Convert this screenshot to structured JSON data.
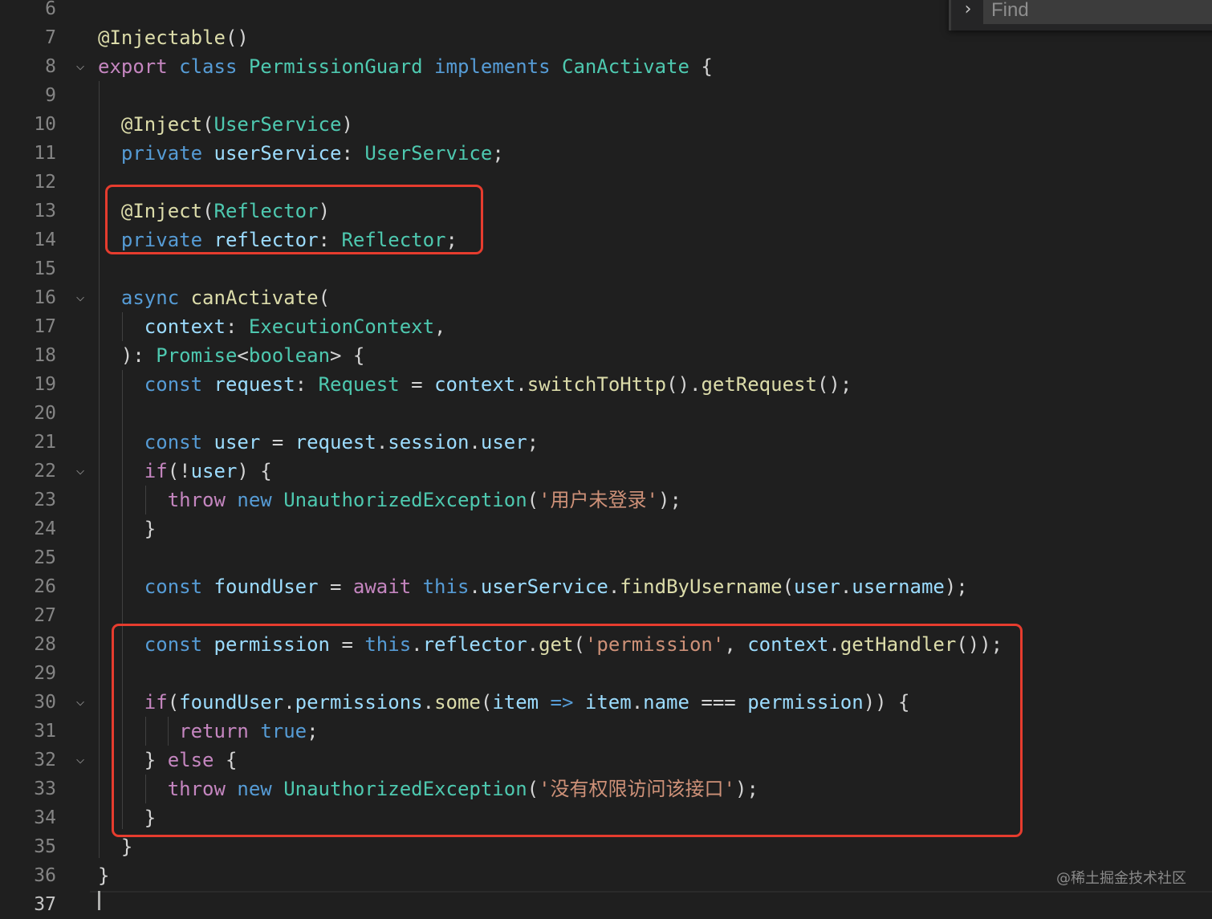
{
  "find": {
    "placeholder": "Find",
    "toggle_icon": "chevron-right-icon"
  },
  "watermark": "@稀土掘金技术社区",
  "colors": {
    "background": "#1f1f1f",
    "keyword": "#569cd6",
    "control": "#c586c0",
    "type": "#4ec9b0",
    "function": "#dcdcaa",
    "variable": "#9cdcfe",
    "string": "#ce9178",
    "highlight_box": "#e63c2e"
  },
  "lines": [
    {
      "n": "6",
      "fold": false,
      "tokens": []
    },
    {
      "n": "7",
      "fold": false,
      "tokens": [
        {
          "t": "@Injectable",
          "c": "deco"
        },
        {
          "t": "()",
          "c": "pun"
        }
      ]
    },
    {
      "n": "8",
      "fold": true,
      "tokens": [
        {
          "t": "export ",
          "c": "ctl"
        },
        {
          "t": "class ",
          "c": "kw"
        },
        {
          "t": "PermissionGuard ",
          "c": "ty"
        },
        {
          "t": "implements ",
          "c": "kw"
        },
        {
          "t": "CanActivate ",
          "c": "ty"
        },
        {
          "t": "{",
          "c": "pun"
        }
      ]
    },
    {
      "n": "9",
      "fold": false,
      "tokens": []
    },
    {
      "n": "10",
      "fold": false,
      "tokens": [
        {
          "t": "  ",
          "c": "pun"
        },
        {
          "t": "@Inject",
          "c": "deco"
        },
        {
          "t": "(",
          "c": "pun"
        },
        {
          "t": "UserService",
          "c": "ty"
        },
        {
          "t": ")",
          "c": "pun"
        }
      ]
    },
    {
      "n": "11",
      "fold": false,
      "tokens": [
        {
          "t": "  ",
          "c": "pun"
        },
        {
          "t": "private ",
          "c": "kw"
        },
        {
          "t": "userService",
          "c": "var"
        },
        {
          "t": ": ",
          "c": "pun"
        },
        {
          "t": "UserService",
          "c": "ty"
        },
        {
          "t": ";",
          "c": "pun"
        }
      ]
    },
    {
      "n": "12",
      "fold": false,
      "tokens": []
    },
    {
      "n": "13",
      "fold": false,
      "tokens": [
        {
          "t": "  ",
          "c": "pun"
        },
        {
          "t": "@Inject",
          "c": "deco"
        },
        {
          "t": "(",
          "c": "pun"
        },
        {
          "t": "Reflector",
          "c": "ty"
        },
        {
          "t": ")",
          "c": "pun"
        }
      ]
    },
    {
      "n": "14",
      "fold": false,
      "tokens": [
        {
          "t": "  ",
          "c": "pun"
        },
        {
          "t": "private ",
          "c": "kw"
        },
        {
          "t": "reflector",
          "c": "var"
        },
        {
          "t": ": ",
          "c": "pun"
        },
        {
          "t": "Reflector",
          "c": "ty"
        },
        {
          "t": ";",
          "c": "pun"
        }
      ]
    },
    {
      "n": "15",
      "fold": false,
      "tokens": []
    },
    {
      "n": "16",
      "fold": true,
      "tokens": [
        {
          "t": "  ",
          "c": "pun"
        },
        {
          "t": "async ",
          "c": "kw"
        },
        {
          "t": "canActivate",
          "c": "fn"
        },
        {
          "t": "(",
          "c": "pun"
        }
      ]
    },
    {
      "n": "17",
      "fold": false,
      "tokens": [
        {
          "t": "    ",
          "c": "pun"
        },
        {
          "t": "context",
          "c": "var"
        },
        {
          "t": ": ",
          "c": "pun"
        },
        {
          "t": "ExecutionContext",
          "c": "ty"
        },
        {
          "t": ",",
          "c": "pun"
        }
      ]
    },
    {
      "n": "18",
      "fold": false,
      "tokens": [
        {
          "t": "  ",
          "c": "pun"
        },
        {
          "t": "): ",
          "c": "pun"
        },
        {
          "t": "Promise",
          "c": "ty"
        },
        {
          "t": "<",
          "c": "pun"
        },
        {
          "t": "boolean",
          "c": "ty"
        },
        {
          "t": "> {",
          "c": "pun"
        }
      ]
    },
    {
      "n": "19",
      "fold": false,
      "tokens": [
        {
          "t": "    ",
          "c": "pun"
        },
        {
          "t": "const ",
          "c": "kw"
        },
        {
          "t": "request",
          "c": "var"
        },
        {
          "t": ": ",
          "c": "pun"
        },
        {
          "t": "Request",
          "c": "ty"
        },
        {
          "t": " = ",
          "c": "pun"
        },
        {
          "t": "context",
          "c": "var"
        },
        {
          "t": ".",
          "c": "pun"
        },
        {
          "t": "switchToHttp",
          "c": "fn"
        },
        {
          "t": "().",
          "c": "pun"
        },
        {
          "t": "getRequest",
          "c": "fn"
        },
        {
          "t": "();",
          "c": "pun"
        }
      ]
    },
    {
      "n": "20",
      "fold": false,
      "tokens": []
    },
    {
      "n": "21",
      "fold": false,
      "tokens": [
        {
          "t": "    ",
          "c": "pun"
        },
        {
          "t": "const ",
          "c": "kw"
        },
        {
          "t": "user",
          "c": "var"
        },
        {
          "t": " = ",
          "c": "pun"
        },
        {
          "t": "request",
          "c": "var"
        },
        {
          "t": ".",
          "c": "pun"
        },
        {
          "t": "session",
          "c": "var"
        },
        {
          "t": ".",
          "c": "pun"
        },
        {
          "t": "user",
          "c": "var"
        },
        {
          "t": ";",
          "c": "pun"
        }
      ]
    },
    {
      "n": "22",
      "fold": true,
      "tokens": [
        {
          "t": "    ",
          "c": "pun"
        },
        {
          "t": "if",
          "c": "ctl"
        },
        {
          "t": "(!",
          "c": "pun"
        },
        {
          "t": "user",
          "c": "var"
        },
        {
          "t": ") {",
          "c": "pun"
        }
      ]
    },
    {
      "n": "23",
      "fold": false,
      "tokens": [
        {
          "t": "      ",
          "c": "pun"
        },
        {
          "t": "throw ",
          "c": "ctl"
        },
        {
          "t": "new ",
          "c": "kw"
        },
        {
          "t": "UnauthorizedException",
          "c": "ty"
        },
        {
          "t": "(",
          "c": "pun"
        },
        {
          "t": "'用户未登录'",
          "c": "str"
        },
        {
          "t": ");",
          "c": "pun"
        }
      ]
    },
    {
      "n": "24",
      "fold": false,
      "tokens": [
        {
          "t": "    ",
          "c": "pun"
        },
        {
          "t": "}",
          "c": "pun"
        }
      ]
    },
    {
      "n": "25",
      "fold": false,
      "tokens": []
    },
    {
      "n": "26",
      "fold": false,
      "tokens": [
        {
          "t": "    ",
          "c": "pun"
        },
        {
          "t": "const ",
          "c": "kw"
        },
        {
          "t": "foundUser",
          "c": "var"
        },
        {
          "t": " = ",
          "c": "pun"
        },
        {
          "t": "await ",
          "c": "ctl"
        },
        {
          "t": "this",
          "c": "kw"
        },
        {
          "t": ".",
          "c": "pun"
        },
        {
          "t": "userService",
          "c": "var"
        },
        {
          "t": ".",
          "c": "pun"
        },
        {
          "t": "findByUsername",
          "c": "fn"
        },
        {
          "t": "(",
          "c": "pun"
        },
        {
          "t": "user",
          "c": "var"
        },
        {
          "t": ".",
          "c": "pun"
        },
        {
          "t": "username",
          "c": "var"
        },
        {
          "t": ");",
          "c": "pun"
        }
      ]
    },
    {
      "n": "27",
      "fold": false,
      "tokens": []
    },
    {
      "n": "28",
      "fold": false,
      "tokens": [
        {
          "t": "    ",
          "c": "pun"
        },
        {
          "t": "const ",
          "c": "kw"
        },
        {
          "t": "permission",
          "c": "var"
        },
        {
          "t": " = ",
          "c": "pun"
        },
        {
          "t": "this",
          "c": "kw"
        },
        {
          "t": ".",
          "c": "pun"
        },
        {
          "t": "reflector",
          "c": "var"
        },
        {
          "t": ".",
          "c": "pun"
        },
        {
          "t": "get",
          "c": "fn"
        },
        {
          "t": "(",
          "c": "pun"
        },
        {
          "t": "'permission'",
          "c": "str"
        },
        {
          "t": ", ",
          "c": "pun"
        },
        {
          "t": "context",
          "c": "var"
        },
        {
          "t": ".",
          "c": "pun"
        },
        {
          "t": "getHandler",
          "c": "fn"
        },
        {
          "t": "());",
          "c": "pun"
        }
      ]
    },
    {
      "n": "29",
      "fold": false,
      "tokens": []
    },
    {
      "n": "30",
      "fold": true,
      "tokens": [
        {
          "t": "    ",
          "c": "pun"
        },
        {
          "t": "if",
          "c": "ctl"
        },
        {
          "t": "(",
          "c": "pun"
        },
        {
          "t": "foundUser",
          "c": "var"
        },
        {
          "t": ".",
          "c": "pun"
        },
        {
          "t": "permissions",
          "c": "var"
        },
        {
          "t": ".",
          "c": "pun"
        },
        {
          "t": "some",
          "c": "fn"
        },
        {
          "t": "(",
          "c": "pun"
        },
        {
          "t": "item",
          "c": "var"
        },
        {
          "t": " => ",
          "c": "kw"
        },
        {
          "t": "item",
          "c": "var"
        },
        {
          "t": ".",
          "c": "pun"
        },
        {
          "t": "name",
          "c": "var"
        },
        {
          "t": " === ",
          "c": "pun"
        },
        {
          "t": "permission",
          "c": "var"
        },
        {
          "t": ")) {",
          "c": "pun"
        }
      ]
    },
    {
      "n": "31",
      "fold": false,
      "tokens": [
        {
          "t": "       ",
          "c": "pun"
        },
        {
          "t": "return ",
          "c": "ctl"
        },
        {
          "t": "true",
          "c": "kw"
        },
        {
          "t": ";",
          "c": "pun"
        }
      ]
    },
    {
      "n": "32",
      "fold": true,
      "tokens": [
        {
          "t": "    ",
          "c": "pun"
        },
        {
          "t": "} ",
          "c": "pun"
        },
        {
          "t": "else",
          "c": "ctl"
        },
        {
          "t": " {",
          "c": "pun"
        }
      ]
    },
    {
      "n": "33",
      "fold": false,
      "tokens": [
        {
          "t": "      ",
          "c": "pun"
        },
        {
          "t": "throw ",
          "c": "ctl"
        },
        {
          "t": "new ",
          "c": "kw"
        },
        {
          "t": "UnauthorizedException",
          "c": "ty"
        },
        {
          "t": "(",
          "c": "pun"
        },
        {
          "t": "'没有权限访问该接口'",
          "c": "str"
        },
        {
          "t": ");",
          "c": "pun"
        }
      ]
    },
    {
      "n": "34",
      "fold": false,
      "tokens": [
        {
          "t": "    ",
          "c": "pun"
        },
        {
          "t": "}",
          "c": "pun"
        }
      ]
    },
    {
      "n": "35",
      "fold": false,
      "tokens": [
        {
          "t": "  ",
          "c": "pun"
        },
        {
          "t": "}",
          "c": "pun"
        }
      ]
    },
    {
      "n": "36",
      "fold": false,
      "tokens": [
        {
          "t": "}",
          "c": "pun"
        }
      ]
    },
    {
      "n": "37",
      "fold": false,
      "current": true,
      "tokens": []
    }
  ]
}
